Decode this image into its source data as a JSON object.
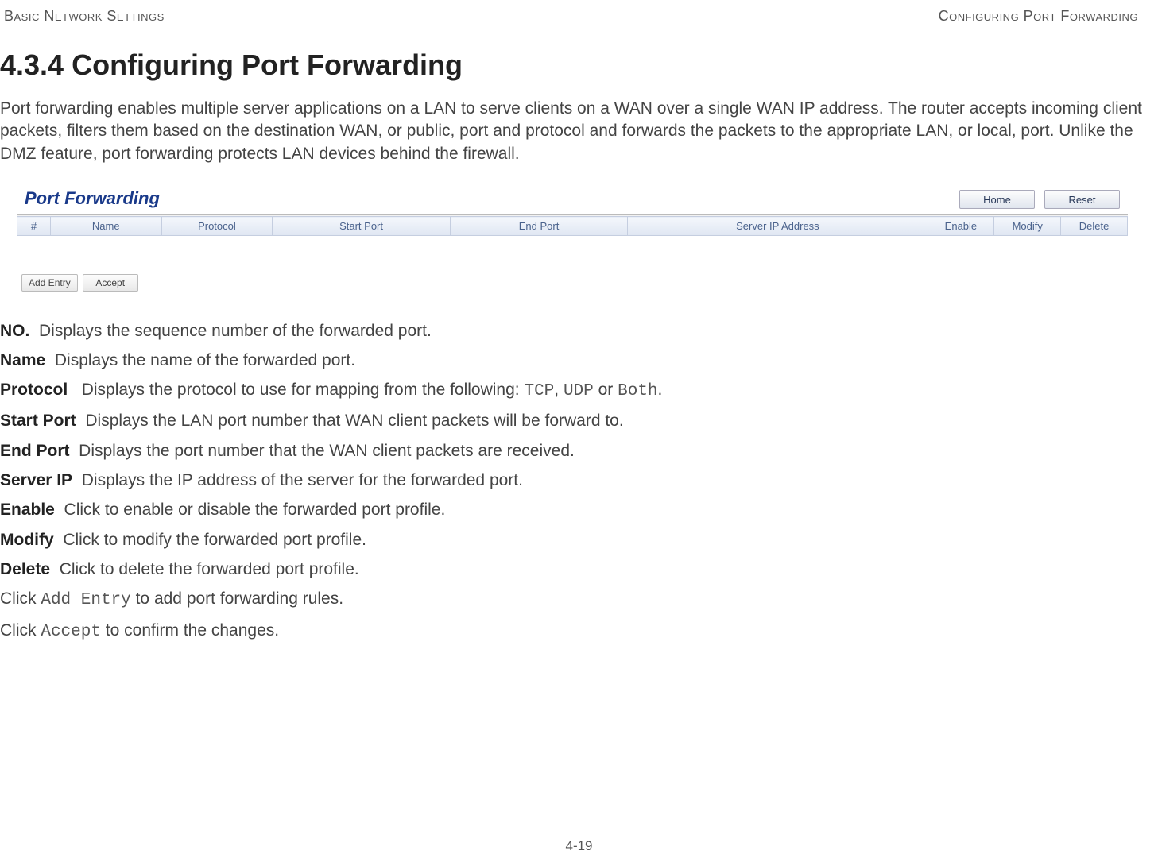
{
  "header": {
    "left": "Basic Network Settings",
    "right": "Configuring Port Forwarding"
  },
  "section": {
    "number": "4.3.4",
    "title": "Configuring Port Forwarding"
  },
  "intro": "Port forwarding enables multiple server applications on a LAN to serve clients on a WAN over a single WAN IP address. The router accepts incoming client packets, filters them based on the destination WAN, or public, port and protocol and forwards the packets to the appropriate LAN, or local, port. Unlike the DMZ feature, port forwarding protects LAN devices behind the firewall.",
  "screenshot": {
    "title": "Port Forwarding",
    "top_buttons": {
      "home": "Home",
      "reset": "Reset"
    },
    "columns": {
      "num": "#",
      "name": "Name",
      "protocol": "Protocol",
      "start": "Start Port",
      "end": "End Port",
      "ip": "Server IP Address",
      "enable": "Enable",
      "modify": "Modify",
      "delete": "Delete"
    },
    "footer_buttons": {
      "add": "Add Entry",
      "accept": "Accept"
    }
  },
  "defs": {
    "no": {
      "term": "NO.",
      "desc_a": "Displays the sequence number of the forwarded port."
    },
    "name": {
      "term": "Name",
      "desc_a": "Displays the name of the forwarded port."
    },
    "proto": {
      "term": "Protocol",
      "desc_a": "Displays the protocol to use for mapping from the following: ",
      "m1": "TCP",
      "sep1": ", ",
      "m2": "UDP",
      "sep2": " or ",
      "m3": "Both",
      "tail": "."
    },
    "start": {
      "term": "Start Port",
      "desc_a": "Displays the LAN port number that WAN client packets will be forward to."
    },
    "end": {
      "term": "End Port",
      "desc_a": "Displays the port number that the WAN client packets are received."
    },
    "ip": {
      "term": "Server IP",
      "desc_a": "Displays the IP address of the server for the forwarded port."
    },
    "enable": {
      "term": "Enable",
      "desc_a": "Click to enable or disable the forwarded port profile."
    },
    "modify": {
      "term": "Modify",
      "desc_a": "Click to modify the forwarded port profile."
    },
    "delete": {
      "term": "Delete",
      "desc_a": "Click to delete the forwarded port profile."
    }
  },
  "actions": {
    "add": {
      "pre": "Click ",
      "mono": "Add Entry",
      "post": " to add port forwarding rules."
    },
    "accept": {
      "pre": "Click ",
      "mono": "Accept",
      "post": " to confirm the changes."
    }
  },
  "page_number": "4-19"
}
